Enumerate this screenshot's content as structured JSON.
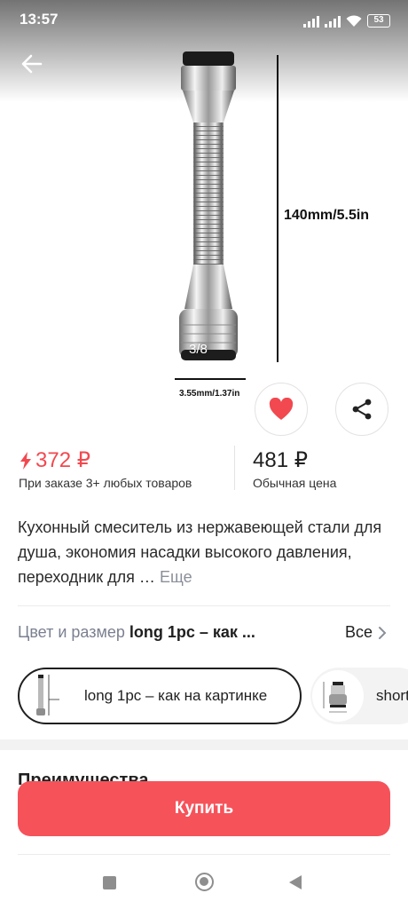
{
  "status_bar": {
    "time": "13:57",
    "battery": "53"
  },
  "product_image": {
    "counter": "3/8",
    "height_label": "140mm/5.5in",
    "width_label": "3.55mm/1.37in"
  },
  "price": {
    "sale": "372 ₽",
    "sale_note": "При заказе 3+ любых товаров",
    "regular": "481 ₽",
    "regular_note": "Обычная цена"
  },
  "description": {
    "text": "Кухонный смеситель из нержавеющей стали для душа, экономия насадки высокого давления, переходник для …",
    "more": "Еще"
  },
  "variant": {
    "label": "Цвет и размер",
    "value": "long  1pc – как ...",
    "all": "Все",
    "options": [
      {
        "label": "long  1pc – как на картинке",
        "selected": true
      },
      {
        "label": "short",
        "selected": false
      }
    ]
  },
  "section_title": "Преимущества",
  "buy_button": "Купить",
  "colors": {
    "accent": "#f6525a",
    "sale_price": "#f1494f"
  }
}
